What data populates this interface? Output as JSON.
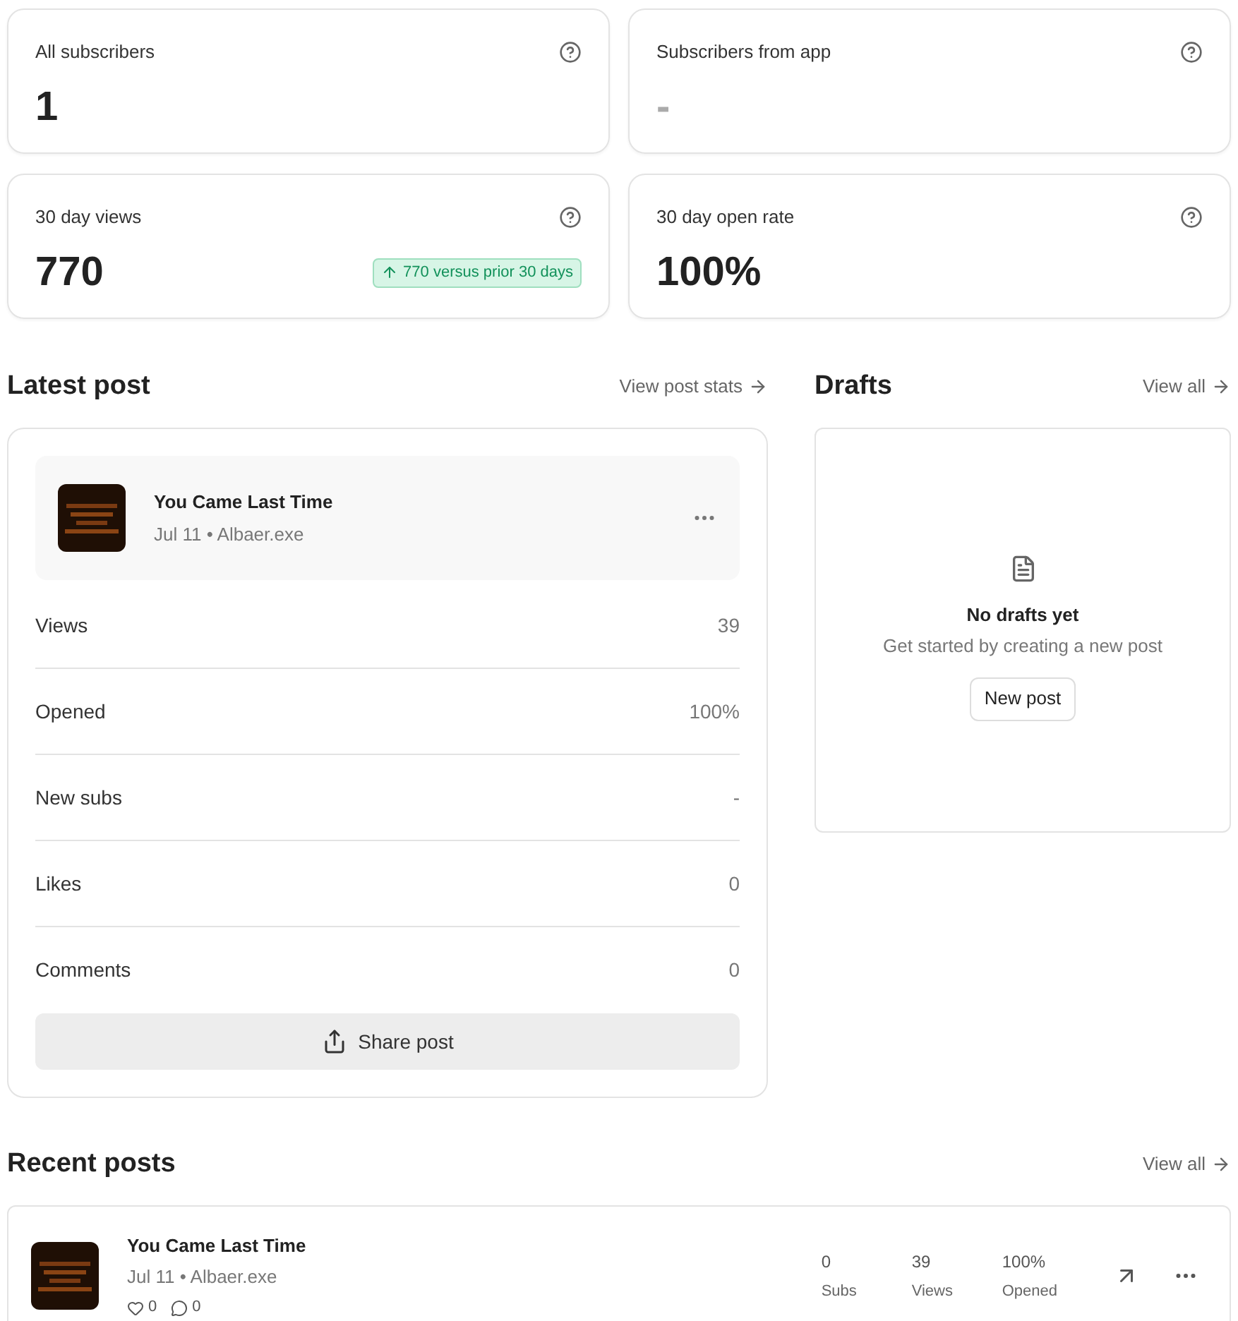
{
  "stats": [
    {
      "label": "All subscribers",
      "value": "1",
      "muted": false
    },
    {
      "label": "Subscribers from app",
      "value": "-",
      "muted": true
    },
    {
      "label": "30 day views",
      "value": "770",
      "muted": false,
      "trend": "770 versus prior 30 days"
    },
    {
      "label": "30 day open rate",
      "value": "100%",
      "muted": false
    }
  ],
  "latest_post": {
    "heading": "Latest post",
    "link": "View post stats",
    "post": {
      "kind": "picture",
      "title": "You Came Last Time",
      "meta": "Jul 11 • Albaer.exe"
    },
    "metrics": [
      {
        "label": "Views",
        "value": "39"
      },
      {
        "label": "Opened",
        "value": "100%"
      },
      {
        "label": "New subs",
        "value": "-"
      },
      {
        "label": "Likes",
        "value": "0"
      },
      {
        "label": "Comments",
        "value": "0"
      }
    ],
    "share_button": "Share post"
  },
  "drafts": {
    "heading": "Drafts",
    "link": "View all",
    "empty_title": "No drafts yet",
    "empty_text": "Get started by creating a new post",
    "button": "New post"
  },
  "recent_posts": {
    "heading": "Recent posts",
    "link": "View all",
    "posts": [
      {
        "title": "You Came Last Time",
        "meta": "Jul 11 • Albaer.exe",
        "likes": "0",
        "comments": "0",
        "stats": [
          {
            "value": "0",
            "label": "Subs"
          },
          {
            "value": "39",
            "label": "Views"
          },
          {
            "value": "100%",
            "label": "Opened"
          }
        ]
      }
    ]
  }
}
